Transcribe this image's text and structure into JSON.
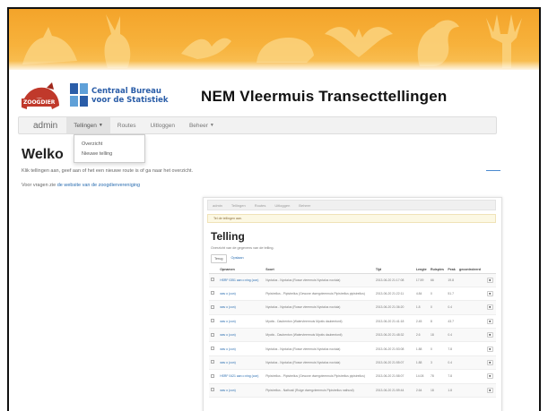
{
  "header": {
    "zoogdier_logo_text": "ZOOGDIER",
    "cbs_line1": "Centraal Bureau",
    "cbs_line2": "voor de Statistiek",
    "site_title": "NEM Vleermuis Transecttellingen"
  },
  "nav": {
    "brand": "admin",
    "items": [
      {
        "label": "Tellingen",
        "dropdown": true,
        "active": true
      },
      {
        "label": "Routes",
        "dropdown": false,
        "active": false
      },
      {
        "label": "Uitloggen",
        "dropdown": false,
        "active": false
      },
      {
        "label": "Beheer",
        "dropdown": true,
        "active": false
      }
    ],
    "dropdown_items": [
      "Overzicht",
      "Nieuwe telling"
    ]
  },
  "main": {
    "welcome_title": "Welko",
    "intro": "Klik tellingen aan, geef aan of het een nieuwe route is of ga naar het overzicht.",
    "contact_prefix": "Voor vragen zie ",
    "contact_link": "de website van de zoogdiervereniging"
  },
  "inner": {
    "nav_items": [
      "admin",
      "Tellingen",
      "Routes",
      "Uitloggen",
      "Beheer"
    ],
    "alert": "Tel de tellingen aan.",
    "title": "Telling",
    "subtitle": "Overzicht van de gegevens van de telling.",
    "buttons": [
      "Terug",
      "Opslaan"
    ],
    "columns": [
      "",
      "Opnamen",
      "Soort",
      "Tijd",
      "Lengte",
      "Ruispies",
      "Peak",
      "gecontroleerd",
      ""
    ],
    "rows": [
      {
        "opname": "HSRF 0351 aan o ning (con)",
        "soort": "Nyctalus - Nyctalus (Rosse vleermuis Nyctalus noctula)",
        "tijd": "2013-06-20 21:17:08",
        "lengte": "17.59",
        "ruis": "66",
        "peak": "19.8"
      },
      {
        "opname": "wav o (con)",
        "soort": "Pipistrellus - Pipistrellus (Gewone dwergvleermuis Pipistrellus pipistrellus)",
        "tijd": "2013-06-20 21:22:11",
        "lengte": "4.84",
        "ruis": "0",
        "peak": "51.7"
      },
      {
        "opname": "wav o (con)",
        "soort": "Nyctalus - Nyctalus (Rosse vleermuis Nyctalus noctula)",
        "tijd": "2013-06-20 21:36:20",
        "lengte": "1.8",
        "ruis": "0",
        "peak": "0.4"
      },
      {
        "opname": "wav o (con)",
        "soort": "Myotis - Daubenton (Watervleermuis Myotis daubentonii)",
        "tijd": "2013-06-20 21:41:18",
        "lengte": "2.45",
        "ruis": "8",
        "peak": "43.7"
      },
      {
        "opname": "wav o (con)",
        "soort": "Myotis - Daubenton (Watervleermuis Myotis daubentonii)",
        "tijd": "2013-06-20 21:48:32",
        "lengte": "2.6",
        "ruis": "18",
        "peak": "0.4"
      },
      {
        "opname": "wav o (con)",
        "soort": "Nyctalus - Nyctalus (Rosse vleermuis Nyctalus noctula)",
        "tijd": "2013-06-20 21:53:08",
        "lengte": "1.88",
        "ruis": "0",
        "peak": "7.8"
      },
      {
        "opname": "wav o (con)",
        "soort": "Nyctalus - Nyctalus (Rosse vleermuis Nyctalus noctula)",
        "tijd": "2013-06-20 21:55:07",
        "lengte": "1.88",
        "ruis": "3",
        "peak": "0.4"
      },
      {
        "opname": "HSRF 0421 aan o ning (con)",
        "soort": "Pipistrellus - Pipistrellus (Gewone dwergvleermuis Pipistrellus pipistrellus)",
        "tijd": "2013-06-20 21:58:07",
        "lengte": "14.08",
        "ruis": "78",
        "peak": "7.8"
      },
      {
        "opname": "wav o (con)",
        "soort": "Pipistrellus - Nathusii (Ruige dwergvleermuis Pipistrellus nathusii)",
        "tijd": "2013-06-20 21:59:44",
        "lengte": "2.64",
        "ruis": "18",
        "peak": "1.8"
      }
    ],
    "row_button": "●"
  },
  "colors": {
    "banner": "#f4a42a",
    "link": "#2a6db0",
    "cbs_blue": "#2a5da8"
  }
}
